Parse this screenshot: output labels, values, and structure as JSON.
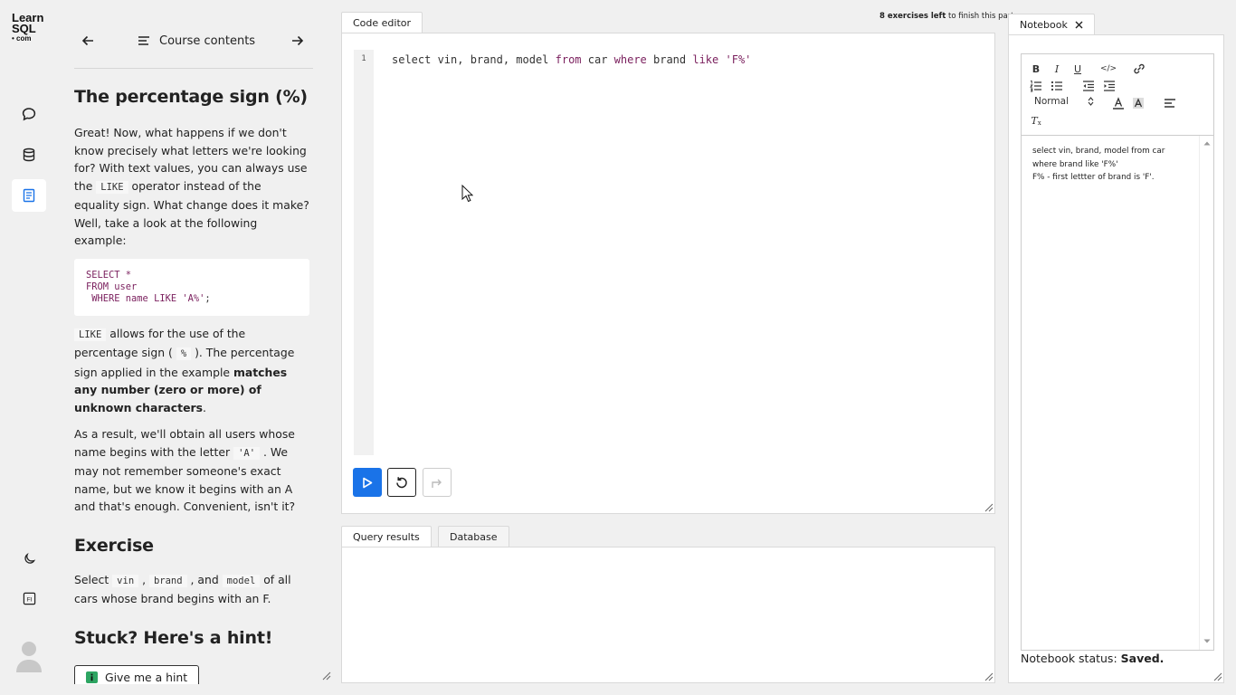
{
  "brand": {
    "logo_line1": "Learn",
    "logo_line2": "SQL",
    "logo_line3": "• com"
  },
  "rail": {
    "items": [
      {
        "icon": "chat-bubble-icon"
      },
      {
        "icon": "database-icon"
      },
      {
        "icon": "document-icon",
        "active": true
      }
    ],
    "bottom": [
      {
        "icon": "moon-icon"
      },
      {
        "icon": "fi-icon",
        "label": "FI"
      }
    ]
  },
  "lesson": {
    "nav_title": "Course contents",
    "heading": "The percentage sign (%)",
    "p1_a": "Great! Now, what happens if we don't know precisely what letters we're looking for? With text values, you can always use the ",
    "p1_code": "LIKE",
    "p1_b": " operator instead of the equality sign. What change does it make? Well, take a look at the following example:",
    "code_l1": "SELECT *",
    "code_l2": "FROM user",
    "code_l3_kw": " WHERE name LIKE ",
    "code_l3_str": "'A%'",
    "code_l3_end": ";",
    "p2_code1": "LIKE",
    "p2_a": " allows for the use of the percentage sign ( ",
    "p2_code2": "%",
    "p2_b": " ). The percentage sign applied in the example ",
    "p2_bold": "matches any number (zero or more) of unknown characters",
    "p2_c": ".",
    "p3_a": "As a result, we'll obtain all users whose name begins with the letter ",
    "p3_code": "'A'",
    "p3_b": " . We may not remember someone's exact name, but we know it begins with an A and that's enough. Convenient, isn't it?",
    "exercise_heading": "Exercise",
    "ex_a": "Select ",
    "ex_code1": "vin",
    "ex_sep1": " , ",
    "ex_code2": "brand",
    "ex_sep2": " , and ",
    "ex_code3": "model",
    "ex_b": " of all cars whose brand begins with an F.",
    "hint_heading": "Stuck? Here's a hint!",
    "hint_button": "Give me a hint"
  },
  "editor": {
    "tab_label": "Code editor",
    "exercises_left_bold": "8 exercises left",
    "exercises_left_rest": " to finish this part",
    "line_number": "1",
    "code_p1": "select vin, brand, model ",
    "code_kw1": "from",
    "code_p2": " car ",
    "code_kw2": "where",
    "code_p3": " brand ",
    "code_kw3": "like",
    "code_p4": " ",
    "code_str": "'F%'"
  },
  "results": {
    "tabs": [
      {
        "label": "Query results",
        "active": true
      },
      {
        "label": "Database",
        "active": false
      }
    ]
  },
  "notebook": {
    "tab_label": "Notebook",
    "format_select": "Normal",
    "text_line1": "select vin, brand, model from car",
    "text_line2": "where brand like 'F%'",
    "text_line3": "F% - first lettter of brand is 'F'.",
    "status_label": "Notebook status: ",
    "status_value": "Saved."
  },
  "colors": {
    "accent": "#1a73e8",
    "keyword": "#7a1f5d",
    "background": "#f0f0f0"
  }
}
